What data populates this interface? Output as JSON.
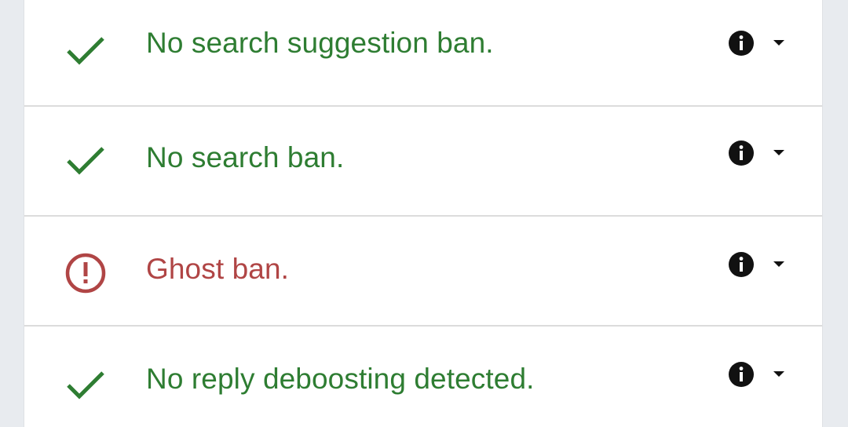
{
  "colors": {
    "ok": "#2e7d32",
    "bad": "#b04545",
    "page_bg": "#e8ebef",
    "card_bg": "#ffffff",
    "divider": "#dcdcdc"
  },
  "results": [
    {
      "status": "ok",
      "status_icon": "check-icon",
      "label": "No search suggestion ban."
    },
    {
      "status": "ok",
      "status_icon": "check-icon",
      "label": "No search ban."
    },
    {
      "status": "bad",
      "status_icon": "exclamation-circle-icon",
      "label": "Ghost ban."
    },
    {
      "status": "ok",
      "status_icon": "check-icon",
      "label": "No reply deboosting detected."
    }
  ]
}
